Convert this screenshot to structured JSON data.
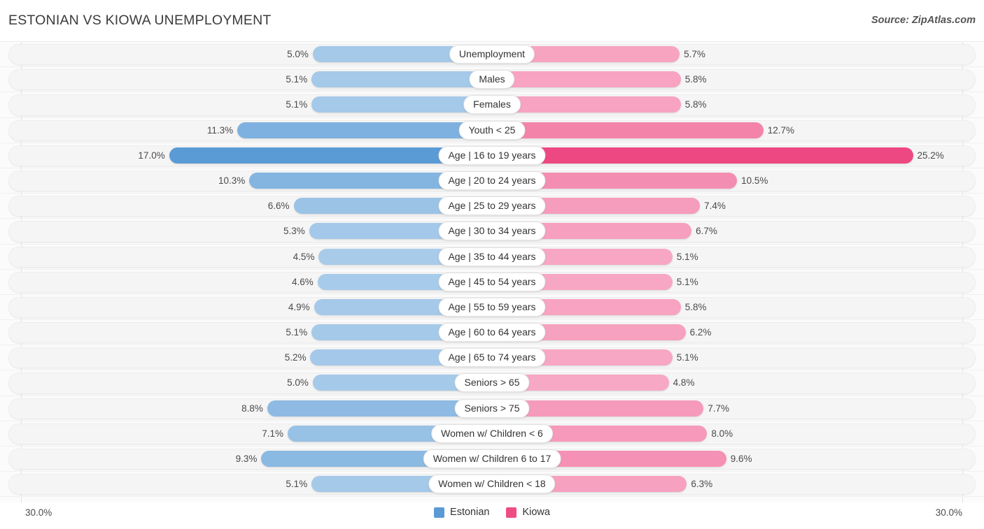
{
  "header": {
    "title": "ESTONIAN VS KIOWA UNEMPLOYMENT",
    "source": "Source: ZipAtlas.com"
  },
  "axis": {
    "min_label": "30.0%",
    "max_label": "30.0%"
  },
  "legend": {
    "items": [
      {
        "label": "Estonian",
        "color": "#5b9bd5"
      },
      {
        "label": "Kiowa",
        "color": "#ee4d84"
      }
    ]
  },
  "chart_data": {
    "type": "bar",
    "title": "ESTONIAN VS KIOWA UNEMPLOYMENT",
    "subtitle": "Source: ZipAtlas.com",
    "orientation": "horizontal-diverging",
    "xlabel": "",
    "ylabel": "",
    "xlim": [
      0,
      30
    ],
    "axis_left_label": "30.0%",
    "axis_right_label": "30.0%",
    "unit": "%",
    "grid": false,
    "legend_position": "bottom-center",
    "categories": [
      "Unemployment",
      "Males",
      "Females",
      "Youth < 25",
      "Age | 16 to 19 years",
      "Age | 20 to 24 years",
      "Age | 25 to 29 years",
      "Age | 30 to 34 years",
      "Age | 35 to 44 years",
      "Age | 45 to 54 years",
      "Age | 55 to 59 years",
      "Age | 60 to 64 years",
      "Age | 65 to 74 years",
      "Seniors > 65",
      "Seniors > 75",
      "Women w/ Children < 6",
      "Women w/ Children 6 to 17",
      "Women w/ Children < 18"
    ],
    "series": [
      {
        "name": "Estonian",
        "color": "#5b9bd5",
        "values": [
          5.0,
          5.1,
          5.1,
          11.3,
          17.0,
          10.3,
          6.6,
          5.3,
          4.5,
          4.6,
          4.9,
          5.1,
          5.2,
          5.0,
          8.8,
          7.1,
          9.3,
          5.1
        ],
        "labels": [
          "5.0%",
          "5.1%",
          "5.1%",
          "11.3%",
          "17.0%",
          "10.3%",
          "6.6%",
          "5.3%",
          "4.5%",
          "4.6%",
          "4.9%",
          "5.1%",
          "5.2%",
          "5.0%",
          "8.8%",
          "7.1%",
          "9.3%",
          "5.1%"
        ]
      },
      {
        "name": "Kiowa",
        "color": "#ee4d84",
        "values": [
          5.7,
          5.8,
          5.8,
          12.7,
          25.2,
          10.5,
          7.4,
          6.7,
          5.1,
          5.1,
          5.8,
          6.2,
          5.1,
          4.8,
          7.7,
          8.0,
          9.6,
          6.3
        ],
        "labels": [
          "5.7%",
          "5.8%",
          "5.8%",
          "12.7%",
          "25.2%",
          "10.5%",
          "7.4%",
          "6.7%",
          "5.1%",
          "5.1%",
          "5.8%",
          "6.2%",
          "5.1%",
          "4.8%",
          "7.7%",
          "8.0%",
          "9.6%",
          "6.3%"
        ]
      }
    ],
    "rows": [
      {
        "label": "Unemployment",
        "left": 5.0,
        "left_label": "5.0%",
        "right": 5.7,
        "right_label": "5.7%"
      },
      {
        "label": "Males",
        "left": 5.1,
        "left_label": "5.1%",
        "right": 5.8,
        "right_label": "5.8%"
      },
      {
        "label": "Females",
        "left": 5.1,
        "left_label": "5.1%",
        "right": 5.8,
        "right_label": "5.8%"
      },
      {
        "label": "Youth < 25",
        "left": 11.3,
        "left_label": "11.3%",
        "right": 12.7,
        "right_label": "12.7%"
      },
      {
        "label": "Age | 16 to 19 years",
        "left": 17.0,
        "left_label": "17.0%",
        "right": 25.2,
        "right_label": "25.2%"
      },
      {
        "label": "Age | 20 to 24 years",
        "left": 10.3,
        "left_label": "10.3%",
        "right": 10.5,
        "right_label": "10.5%"
      },
      {
        "label": "Age | 25 to 29 years",
        "left": 6.6,
        "left_label": "6.6%",
        "right": 7.4,
        "right_label": "7.4%"
      },
      {
        "label": "Age | 30 to 34 years",
        "left": 5.3,
        "left_label": "5.3%",
        "right": 6.7,
        "right_label": "6.7%"
      },
      {
        "label": "Age | 35 to 44 years",
        "left": 4.5,
        "left_label": "4.5%",
        "right": 5.1,
        "right_label": "5.1%"
      },
      {
        "label": "Age | 45 to 54 years",
        "left": 4.6,
        "left_label": "4.6%",
        "right": 5.1,
        "right_label": "5.1%"
      },
      {
        "label": "Age | 55 to 59 years",
        "left": 4.9,
        "left_label": "4.9%",
        "right": 5.8,
        "right_label": "5.8%"
      },
      {
        "label": "Age | 60 to 64 years",
        "left": 5.1,
        "left_label": "5.1%",
        "right": 6.2,
        "right_label": "6.2%"
      },
      {
        "label": "Age | 65 to 74 years",
        "left": 5.2,
        "left_label": "5.2%",
        "right": 5.1,
        "right_label": "5.1%"
      },
      {
        "label": "Seniors > 65",
        "left": 5.0,
        "left_label": "5.0%",
        "right": 4.8,
        "right_label": "4.8%"
      },
      {
        "label": "Seniors > 75",
        "left": 8.8,
        "left_label": "8.8%",
        "right": 7.7,
        "right_label": "7.7%"
      },
      {
        "label": "Women w/ Children < 6",
        "left": 7.1,
        "left_label": "7.1%",
        "right": 8.0,
        "right_label": "8.0%"
      },
      {
        "label": "Women w/ Children 6 to 17",
        "left": 9.3,
        "left_label": "9.3%",
        "right": 9.6,
        "right_label": "9.6%"
      },
      {
        "label": "Women w/ Children < 18",
        "left": 5.1,
        "left_label": "5.1%",
        "right": 6.3,
        "right_label": "6.3%"
      }
    ]
  }
}
